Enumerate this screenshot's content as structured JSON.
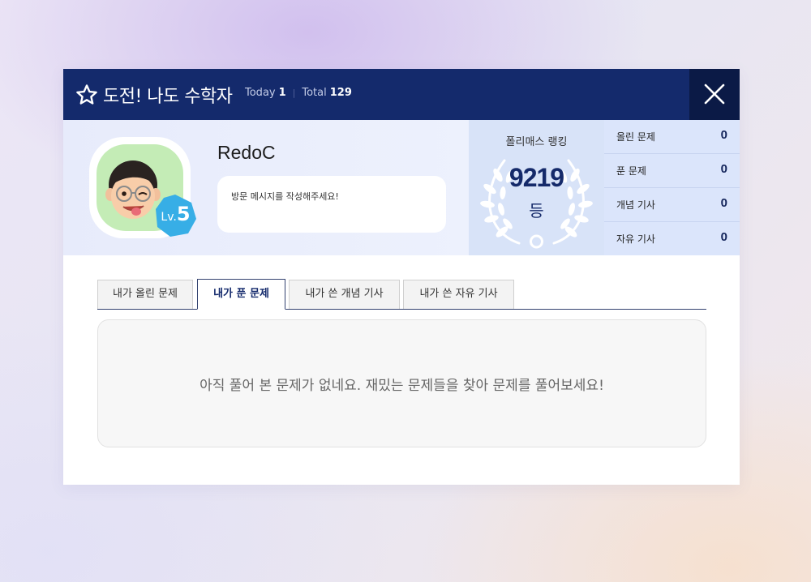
{
  "header": {
    "title": "도전! 나도 수학자",
    "today_label": "Today",
    "today_count": "1",
    "total_label": "Total",
    "total_count": "129",
    "separator": "|",
    "background_color": "#142a6c"
  },
  "profile": {
    "username": "RedoC",
    "level_prefix": "Lv.",
    "level": "5",
    "message_placeholder": "방문 메시지를 작성해주세요!"
  },
  "ranking": {
    "label": "폴리매스 랭킹",
    "rank": "9219",
    "unit": "등"
  },
  "counts": [
    {
      "label": "올린 문제",
      "value": "0"
    },
    {
      "label": "푼 문제",
      "value": "0"
    },
    {
      "label": "개념 기사",
      "value": "0"
    },
    {
      "label": "자유 기사",
      "value": "0"
    }
  ],
  "tabs": [
    {
      "label": "내가 올린 문제",
      "active": false
    },
    {
      "label": "내가 푼 문제",
      "active": true
    },
    {
      "label": "내가 쓴 개념 기사",
      "active": false
    },
    {
      "label": "내가 쓴 자유 기사",
      "active": false
    }
  ],
  "empty_message": "아직 풀어 본 문제가 없네요. 재밌는 문제들을 찾아 문제를 풀어보세요!",
  "icons": {
    "title_icon": "star-icon",
    "close_icon": "close-icon",
    "rank_decoration": "laurel-wreath-icon"
  }
}
